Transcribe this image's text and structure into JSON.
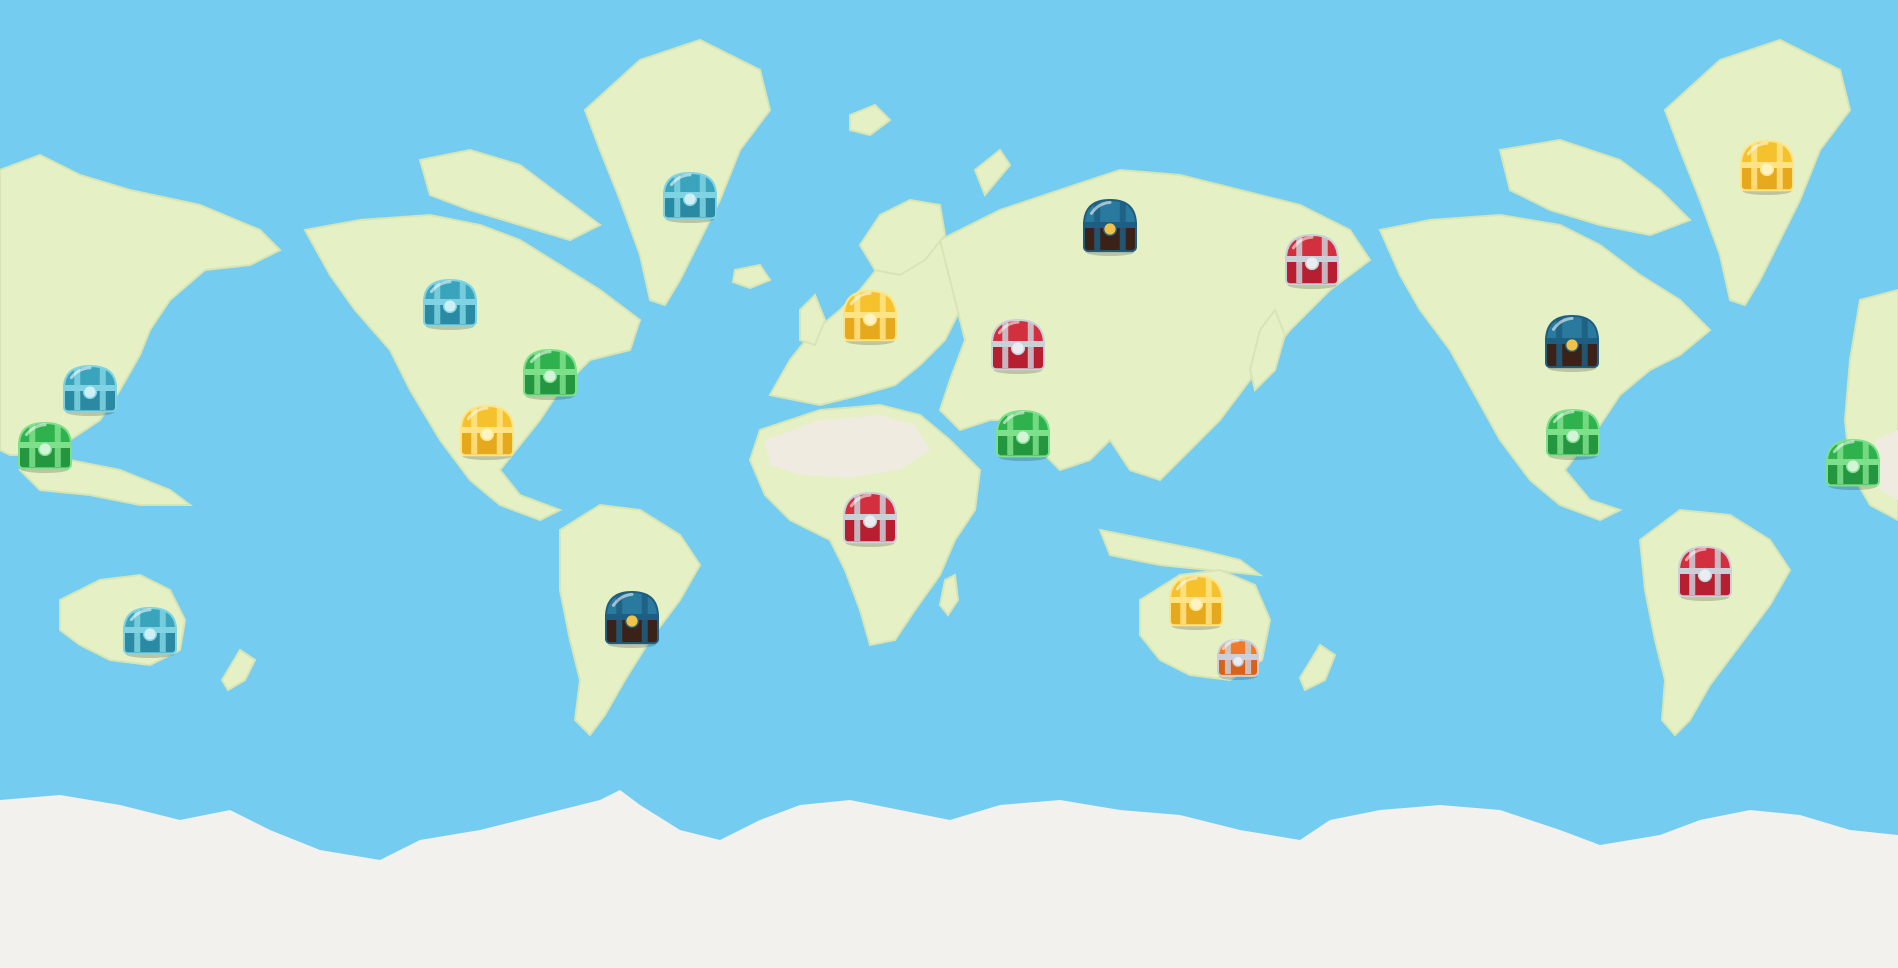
{
  "map": {
    "colors": {
      "ocean": "#74cdf0",
      "land": "#e6f0c5",
      "desert": "#efebe0",
      "ice": "#f2f1ed",
      "coast": "#d7e5b4"
    },
    "chest_types": {
      "teal-gem": {
        "lid": "#3aa4bc",
        "body": "#2b8aa3",
        "trim": "#7fd3e2",
        "band": "#cdeff5"
      },
      "green-gem": {
        "lid": "#2fb24e",
        "body": "#23963f",
        "trim": "#7fe08c",
        "band": "#d2f4d7"
      },
      "gold": {
        "lid": "#f5c22d",
        "body": "#e6a81c",
        "trim": "#ffe486",
        "band": "#fff3c4"
      },
      "red-silver": {
        "lid": "#d3303f",
        "body": "#b71f30",
        "trim": "#c9d0d8",
        "band": "#e9edf2"
      },
      "dark-wood": {
        "lid": "#2a7aa0",
        "body": "#3b2218",
        "trim": "#1e5e80",
        "band": "#f0c24a"
      },
      "orange-silver": {
        "lid": "#f07a2a",
        "body": "#d9621a",
        "trim": "#c9d0d8",
        "band": "#e9edf2"
      }
    },
    "chests": [
      {
        "type": "teal-gem",
        "icon": "teal-gem-chest-icon"
      },
      {
        "type": "teal-gem",
        "icon": "teal-gem-chest-icon"
      },
      {
        "type": "teal-gem",
        "icon": "teal-gem-chest-icon"
      },
      {
        "type": "teal-gem",
        "icon": "teal-gem-chest-icon"
      },
      {
        "type": "green-gem",
        "icon": "green-gem-chest-icon"
      },
      {
        "type": "green-gem",
        "icon": "green-gem-chest-icon"
      },
      {
        "type": "green-gem",
        "icon": "green-gem-chest-icon"
      },
      {
        "type": "green-gem",
        "icon": "green-gem-chest-icon"
      },
      {
        "type": "green-gem",
        "icon": "green-gem-chest-icon"
      },
      {
        "type": "gold",
        "icon": "gold-chest-icon"
      },
      {
        "type": "gold",
        "icon": "gold-chest-icon"
      },
      {
        "type": "gold",
        "icon": "gold-chest-icon"
      },
      {
        "type": "gold",
        "icon": "gold-chest-icon"
      },
      {
        "type": "red-silver",
        "icon": "red-silver-chest-icon"
      },
      {
        "type": "red-silver",
        "icon": "red-silver-chest-icon"
      },
      {
        "type": "red-silver",
        "icon": "red-silver-chest-icon"
      },
      {
        "type": "red-silver",
        "icon": "red-silver-chest-icon"
      },
      {
        "type": "dark-wood",
        "icon": "dark-wood-chest-icon"
      },
      {
        "type": "dark-wood",
        "icon": "dark-wood-chest-icon"
      },
      {
        "type": "dark-wood",
        "icon": "dark-wood-chest-icon"
      },
      {
        "type": "orange-silver",
        "icon": "orange-silver-chest-icon"
      }
    ]
  }
}
